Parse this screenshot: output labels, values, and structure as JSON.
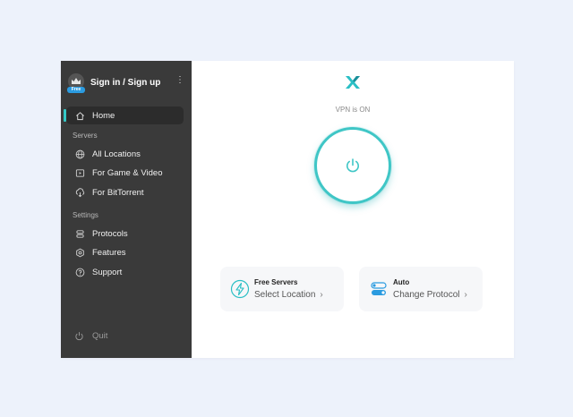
{
  "account": {
    "name": "Sign in / Sign up",
    "badge": "Free"
  },
  "sidebar": {
    "home": "Home",
    "servers_label": "Servers",
    "servers": [
      "All Locations",
      "For Game & Video",
      "For BitTorrent"
    ],
    "settings_label": "Settings",
    "settings": [
      "Protocols",
      "Features",
      "Support"
    ],
    "quit": "Quit"
  },
  "main": {
    "status": "VPN is ON",
    "cards": [
      {
        "title": "Free Servers",
        "subtitle": "Select Location"
      },
      {
        "title": "Auto",
        "subtitle": "Change Protocol"
      }
    ]
  },
  "colors": {
    "accent": "#34c8c6",
    "sidebar_bg": "#3a3a3a",
    "badge": "#2b9be0",
    "page_bg": "#edf2fb"
  },
  "icons": [
    "crown-icon",
    "more-icon",
    "home-icon",
    "globe-icon",
    "play-icon",
    "torrent-icon",
    "protocol-icon",
    "features-icon",
    "help-icon",
    "power-icon",
    "logo-icon",
    "lightning-icon",
    "toggle-icon",
    "chevron-right-icon"
  ]
}
